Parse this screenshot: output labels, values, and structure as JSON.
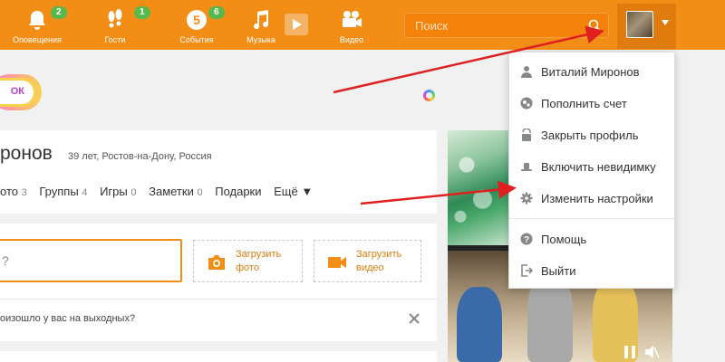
{
  "nav": {
    "items": [
      {
        "label": "Оповещения",
        "badge": "2",
        "icon": "bell-icon"
      },
      {
        "label": "Гости",
        "badge": "1",
        "icon": "footprints-icon"
      },
      {
        "label": "События",
        "badge": "6",
        "icon": "events-icon",
        "icon_text": "5"
      },
      {
        "label": "Музыка",
        "badge": "",
        "icon": "music-note-icon"
      },
      {
        "label": "Видео",
        "badge": "",
        "icon": "video-camera-icon"
      }
    ],
    "search_placeholder": "Поиск"
  },
  "ok_pill": "ОК",
  "profile": {
    "name": "ронов",
    "info": "39 лет, Ростов-на-Дону, Россия",
    "tabs": [
      {
        "label": "ото",
        "count": "3"
      },
      {
        "label": "Группы",
        "count": "4"
      },
      {
        "label": "Игры",
        "count": "0"
      },
      {
        "label": "Заметки",
        "count": "0"
      },
      {
        "label": "Подарки",
        "count": ""
      },
      {
        "label": "Ещё ▼",
        "count": ""
      }
    ]
  },
  "post": {
    "input_text": "?",
    "upload_photo": [
      "Загрузить",
      "фото"
    ],
    "upload_video": [
      "Загрузить",
      "видео"
    ],
    "prompt": "оизошло у вас на выходных?"
  },
  "dropdown": {
    "items": [
      {
        "label": "Виталий Миронов",
        "icon": "user-icon"
      },
      {
        "label": "Пополнить счет",
        "icon": "coins-icon"
      },
      {
        "label": "Закрыть профиль",
        "icon": "lock-icon"
      },
      {
        "label": "Включить невидимку",
        "icon": "hat-icon"
      },
      {
        "label": "Изменить настройки",
        "icon": "gear-icon"
      },
      {
        "label": "Помощь",
        "icon": "help-icon"
      },
      {
        "label": "Выйти",
        "icon": "logout-icon"
      }
    ]
  },
  "colors": {
    "brand_orange": "#f28e15",
    "badge_green": "#59b84b",
    "annotation_red": "#e02020"
  }
}
